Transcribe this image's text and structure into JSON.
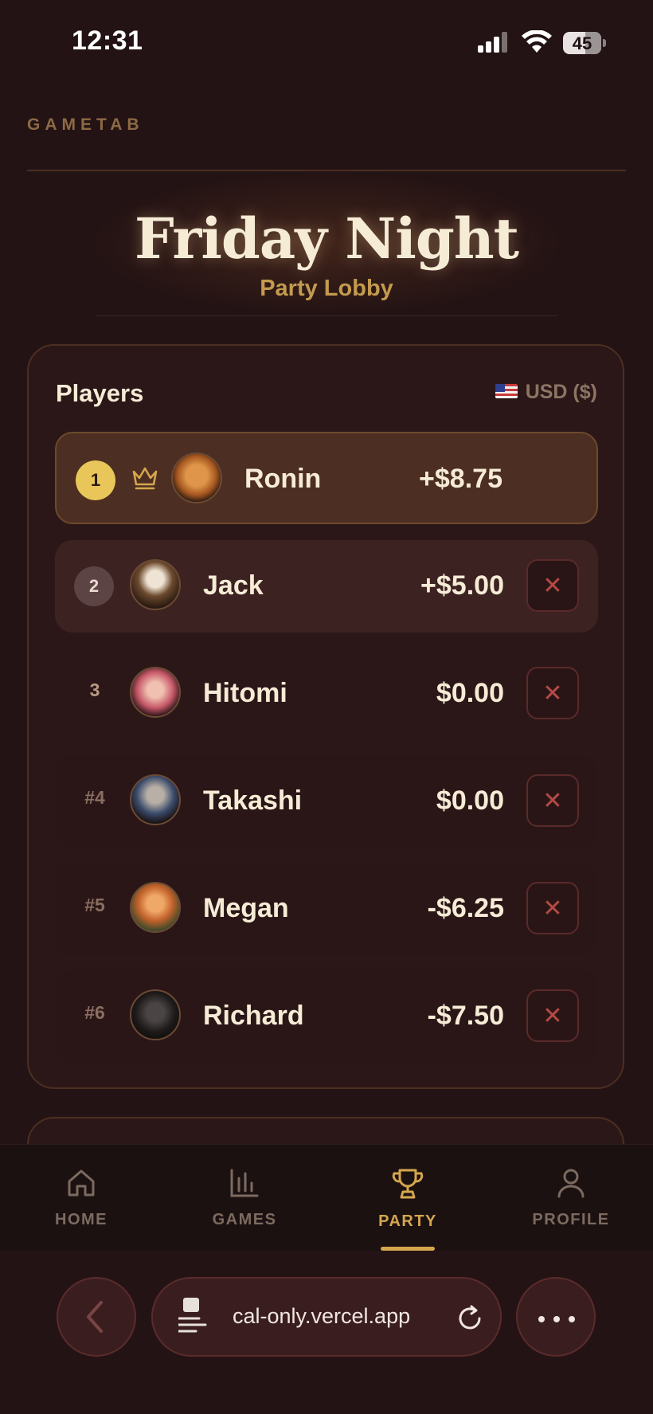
{
  "status": {
    "time": "12:31",
    "battery": "45"
  },
  "brand": "GAMETAB",
  "header": {
    "title": "Friday Night",
    "subtitle": "Party Lobby"
  },
  "players_card": {
    "title": "Players",
    "currency": "USD ($)",
    "players": [
      {
        "rank": "1",
        "name": "Ronin",
        "amount": "+$8.75",
        "leader": true
      },
      {
        "rank": "2",
        "name": "Jack",
        "amount": "+$5.00"
      },
      {
        "rank": "3",
        "name": "Hitomi",
        "amount": "$0.00"
      },
      {
        "rank": "#4",
        "name": "Takashi",
        "amount": "$0.00"
      },
      {
        "rank": "#5",
        "name": "Megan",
        "amount": "-$6.25"
      },
      {
        "rank": "#6",
        "name": "Richard",
        "amount": "-$7.50"
      }
    ]
  },
  "tabs": [
    {
      "label": "HOME",
      "icon": "home-icon"
    },
    {
      "label": "GAMES",
      "icon": "bar-chart-icon"
    },
    {
      "label": "PARTY",
      "icon": "trophy-icon",
      "active": true
    },
    {
      "label": "PROFILE",
      "icon": "user-icon"
    }
  ],
  "browser": {
    "url": "cal-only.vercel.app"
  },
  "colors": {
    "accent": "#d4a64e",
    "gold_badge": "#e9c65a",
    "background": "#241314",
    "remove_red": "#b44a45"
  }
}
